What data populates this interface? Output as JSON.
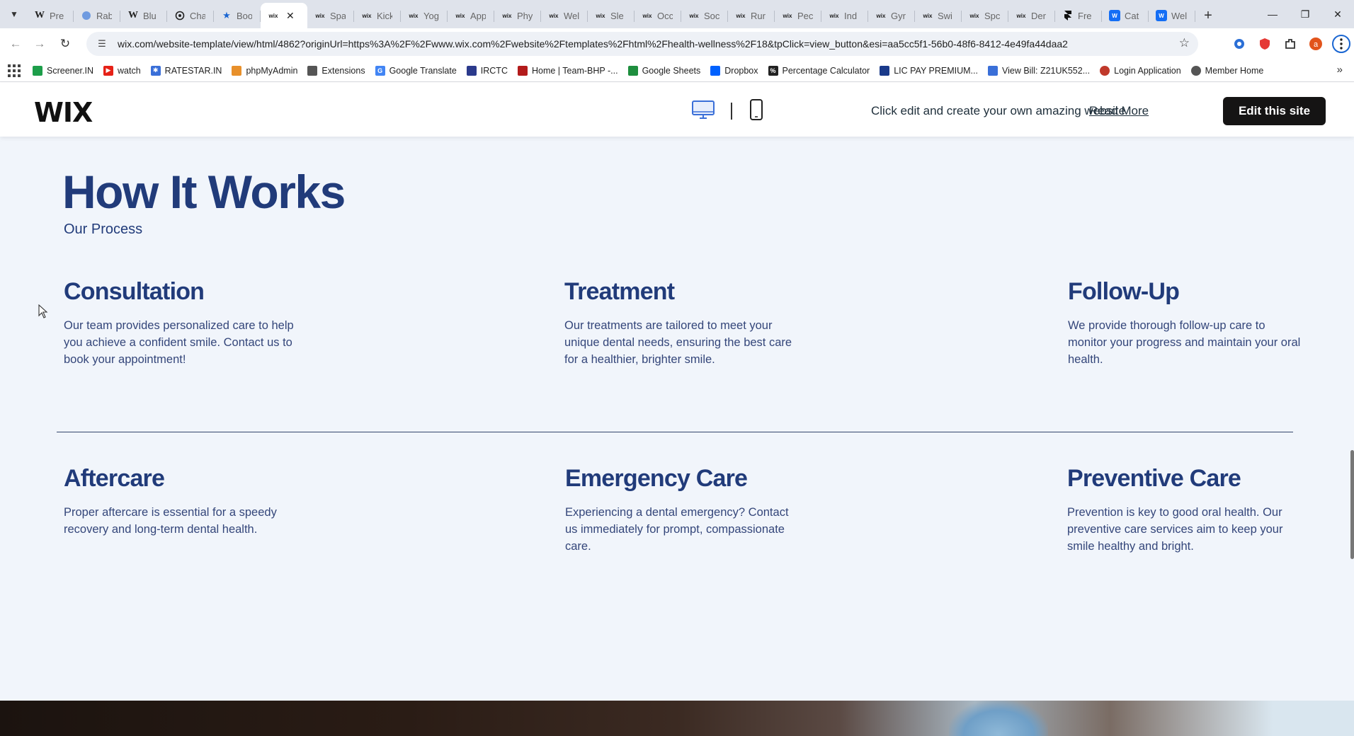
{
  "browser": {
    "tabs": [
      {
        "icon": "W",
        "title": "Pre"
      },
      {
        "icon": "globe",
        "title": "Rab"
      },
      {
        "icon": "W",
        "title": "Blu"
      },
      {
        "icon": "openai",
        "title": "Cha"
      },
      {
        "icon": "star",
        "title": "Boo"
      },
      {
        "icon": "wix",
        "title": "",
        "active": true
      },
      {
        "icon": "wix",
        "title": "Spa"
      },
      {
        "icon": "wix",
        "title": "Kick"
      },
      {
        "icon": "wix",
        "title": "Yog"
      },
      {
        "icon": "wix",
        "title": "App"
      },
      {
        "icon": "wix",
        "title": "Phy"
      },
      {
        "icon": "wix",
        "title": "Wel"
      },
      {
        "icon": "wix",
        "title": "Sle"
      },
      {
        "icon": "wix",
        "title": "Occ"
      },
      {
        "icon": "wix",
        "title": "Soc"
      },
      {
        "icon": "wix",
        "title": "Rur"
      },
      {
        "icon": "wix",
        "title": "Pec"
      },
      {
        "icon": "wix",
        "title": "Ind"
      },
      {
        "icon": "wix",
        "title": "Gyr"
      },
      {
        "icon": "wix",
        "title": "Swi"
      },
      {
        "icon": "wix",
        "title": "Spc"
      },
      {
        "icon": "wix",
        "title": "Der"
      },
      {
        "icon": "framer",
        "title": "Fre"
      },
      {
        "icon": "wblue",
        "title": "Cat"
      },
      {
        "icon": "wblue",
        "title": "Wel"
      }
    ],
    "url": "wix.com/website-template/view/html/4862?originUrl=https%3A%2F%2Fwww.wix.com%2Fwebsite%2Ftemplates%2Fhtml%2Fhealth-wellness%2F18&tpClick=view_button&esi=aa5cc5f1-56b0-48f6-8412-4e49fa44daa2",
    "bookmarks": [
      {
        "label": "Screener.IN",
        "color": "#1d9e4a"
      },
      {
        "label": "watch",
        "color": "#e62117"
      },
      {
        "label": "RATESTAR.IN",
        "color": "#3a6fd8"
      },
      {
        "label": "phpMyAdmin",
        "color": "#e8902b"
      },
      {
        "label": "Extensions",
        "color": "#555555"
      },
      {
        "label": "Google Translate",
        "color": "#4285f4"
      },
      {
        "label": "IRCTC",
        "color": "#2b3a8c"
      },
      {
        "label": "Home | Team-BHP -...",
        "color": "#b31b1b"
      },
      {
        "label": "Google Sheets",
        "color": "#1e8e3e"
      },
      {
        "label": "Dropbox",
        "color": "#0061fe"
      },
      {
        "label": "Percentage Calculator",
        "color": "#222222"
      },
      {
        "label": "LIC PAY PREMIUM...",
        "color": "#1a3a8a"
      },
      {
        "label": "View Bill: Z21UK552...",
        "color": "#3a6fd8"
      },
      {
        "label": "Login Application",
        "color": "#c0392b"
      },
      {
        "label": "Member Home",
        "color": "#555555"
      }
    ]
  },
  "wix": {
    "logo": "WIX",
    "promo": "Click edit and create your own amazing website",
    "read_more": "Read More",
    "edit_button": "Edit this site"
  },
  "section": {
    "title": "How It Works",
    "subtitle": "Our Process",
    "steps": [
      {
        "title": "Consultation",
        "text": "Our team provides personalized care to help you achieve a confident smile. Contact us to book your appointment!"
      },
      {
        "title": "Treatment",
        "text": "Our treatments are tailored to meet your unique dental needs, ensuring the best care for a healthier, brighter smile."
      },
      {
        "title": "Follow-Up",
        "text": "We provide thorough follow-up care to monitor your progress and maintain your oral health."
      },
      {
        "title": "Aftercare",
        "text": "Proper aftercare is essential for a speedy recovery and long-term dental health."
      },
      {
        "title": "Emergency Care",
        "text": "Experiencing a dental emergency? Contact us immediately for prompt, compassionate care."
      },
      {
        "title": "Preventive Care",
        "text": "Prevention is key to good oral health. Our preventive care services aim to keep your smile healthy and bright."
      }
    ]
  },
  "colors": {
    "heading": "#213b7a",
    "page_bg": "#f1f5fb",
    "button_bg": "#151414"
  }
}
